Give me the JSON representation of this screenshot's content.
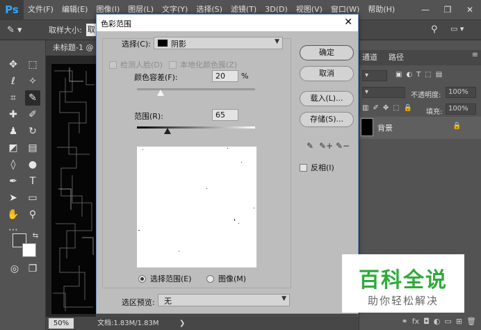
{
  "app": {
    "logo": "Ps",
    "menu": [
      "文件(F)",
      "编辑(E)",
      "图像(I)",
      "图层(L)",
      "文字(Y)",
      "选择(S)",
      "滤镜(T)",
      "3D(D)",
      "视图(V)",
      "窗口(W)",
      "帮助(H)"
    ],
    "window_controls": [
      "—",
      "❐",
      "✕"
    ]
  },
  "options_bar": {
    "sample_size_label": "取样大小:",
    "sample_size_value": "取"
  },
  "document": {
    "tab_title": "未标题-1 @",
    "zoom": "50%",
    "doc_size": "文档:1.83M/1.83M",
    "arrow": "❯"
  },
  "right_panel": {
    "tabs": [
      "通道",
      "路径"
    ],
    "opacity_label": "不透明度:",
    "opacity_value": "100%",
    "fill_label": "填充:",
    "fill_value": "100%",
    "layer_name": "背景"
  },
  "dialog": {
    "title": "色彩范围",
    "select_label": "选择(C):",
    "select_value": "阴影",
    "select_swatch_color": "#000000",
    "detect_faces_label": "检测人脸(D)",
    "localized_label": "本地化颜色簇(Z)",
    "fuzziness_label": "颜色容差(F):",
    "fuzziness_value": "20",
    "fuzziness_unit": "%",
    "fuzziness_slider": 0.2,
    "range_label": "范围(R):",
    "range_value": "65",
    "range_slider": 0.26,
    "radio_selection_label": "选择范围(E)",
    "radio_image_label": "图像(M)",
    "preview_label": "选区预览:",
    "preview_value": "无",
    "buttons": {
      "ok": "确定",
      "cancel": "取消",
      "load": "载入(L)...",
      "save": "存储(S)..."
    },
    "invert_label": "反相(I)"
  },
  "watermark": {
    "title": "百科全说",
    "subtitle": "助你轻松解决",
    "title_color": "#2faa3a"
  }
}
